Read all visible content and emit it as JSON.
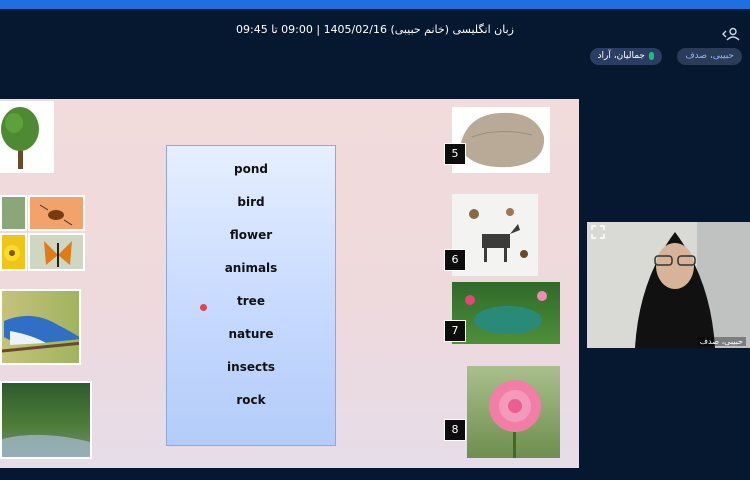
{
  "header": {
    "session_title": "زبان انگلیسی (خانم حبیبی) 1405/02/16 | 09:00 تا 09:45"
  },
  "participants": {
    "chip_1": "حبیبی، صدف",
    "chip_2": "جمالیان، آراد"
  },
  "slide": {
    "words": [
      "pond",
      "bird",
      "flower",
      "animals",
      "tree",
      "nature",
      "insects",
      "rock"
    ],
    "badges": [
      "5",
      "6",
      "7",
      "8"
    ]
  },
  "video": {
    "name": "حبیبی، صدف"
  },
  "icons": {
    "user": "user-icon",
    "expand": "expand-icon",
    "mic": "microphone-icon"
  },
  "colors": {
    "background": "#06182f",
    "topbar": "#1f6fe0",
    "wordbox": "#c9dbff"
  }
}
